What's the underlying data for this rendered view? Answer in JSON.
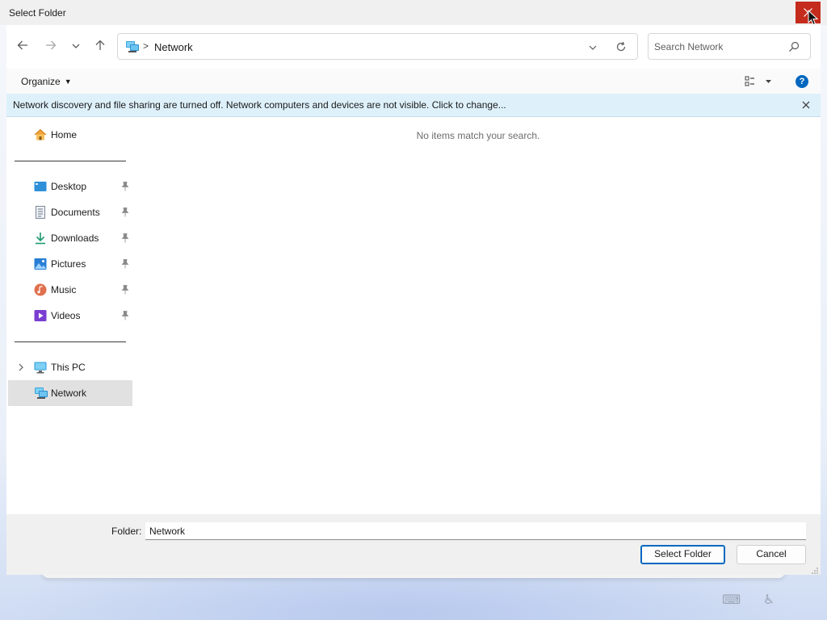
{
  "window": {
    "title": "Select Folder"
  },
  "address_bar": {
    "location": "Network",
    "separator": ">"
  },
  "search": {
    "placeholder": "Search Network"
  },
  "command_bar": {
    "organize_label": "Organize"
  },
  "info_bar": {
    "message": "Network discovery and file sharing are turned off. Network computers and devices are not visible. Click to change..."
  },
  "sidebar": {
    "home": "Home",
    "quick_access": [
      {
        "label": "Desktop",
        "icon": "desktop-icon"
      },
      {
        "label": "Documents",
        "icon": "documents-icon"
      },
      {
        "label": "Downloads",
        "icon": "downloads-icon"
      },
      {
        "label": "Pictures",
        "icon": "pictures-icon"
      },
      {
        "label": "Music",
        "icon": "music-icon"
      },
      {
        "label": "Videos",
        "icon": "videos-icon"
      }
    ],
    "this_pc": "This PC",
    "network": "Network",
    "selected": "Network"
  },
  "main": {
    "empty_message": "No items match your search."
  },
  "footer": {
    "folder_label": "Folder:",
    "folder_value": "Network",
    "select_button": "Select Folder",
    "cancel_button": "Cancel"
  },
  "colors": {
    "close_red": "#c42b1c",
    "info_bar_bg": "#def1fb",
    "accent": "#0067c0",
    "selection_bg": "#e1e1e1"
  }
}
